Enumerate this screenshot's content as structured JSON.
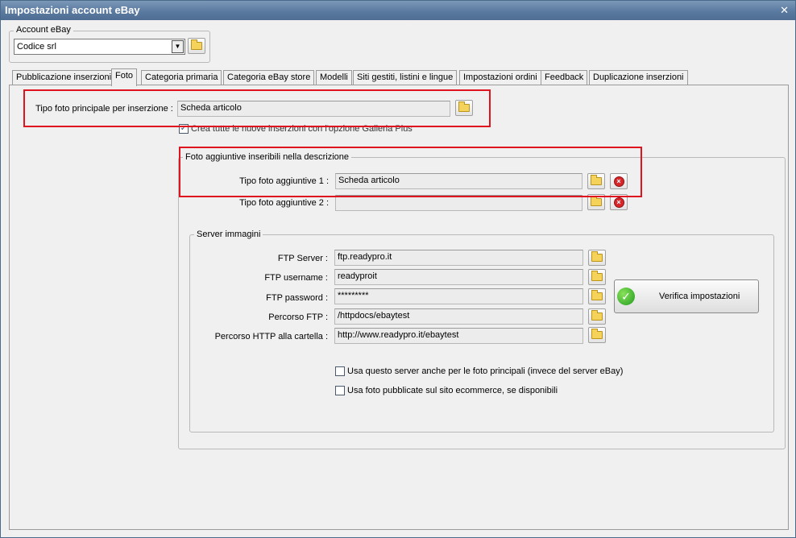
{
  "window": {
    "title": "Impostazioni account eBay",
    "close_glyph": "✕"
  },
  "account": {
    "group_label": "Account eBay",
    "selected": "Codice srl"
  },
  "tabs": [
    {
      "label": "Pubblicazione inserzioni",
      "active": false
    },
    {
      "label": "Foto",
      "active": true
    },
    {
      "label": "Categoria primaria",
      "active": false
    },
    {
      "label": "Categoria eBay store",
      "active": false
    },
    {
      "label": "Modelli",
      "active": false
    },
    {
      "label": "Siti gestiti, listini e lingue",
      "active": false
    },
    {
      "label": "Impostazioni ordini",
      "active": false
    },
    {
      "label": "Feedback",
      "active": false
    },
    {
      "label": "Duplicazione inserzioni",
      "active": false
    }
  ],
  "main_photo": {
    "label": "Tipo foto principale per inserzione :",
    "value": "Scheda articolo"
  },
  "gallery_plus": {
    "label": "Crea tutte le nuove inserzioni con l'opzione Galleria Plus",
    "checked": true
  },
  "additional": {
    "group_label": "Foto aggiuntive inseribili nella descrizione",
    "photo1_label": "Tipo foto aggiuntive 1 :",
    "photo1_value": "Scheda articolo",
    "photo2_label": "Tipo foto aggiuntive 2 :",
    "photo2_value": ""
  },
  "server": {
    "group_label": "Server immagini",
    "ftp_server_label": "FTP Server :",
    "ftp_server_value": "ftp.readypro.it",
    "ftp_username_label": "FTP username :",
    "ftp_username_value": "readyproit",
    "ftp_password_label": "FTP password :",
    "ftp_password_value": "*********",
    "ftp_path_label": "Percorso FTP :",
    "ftp_path_value": "/httpdocs/ebaytest",
    "http_path_label": "Percorso HTTP alla cartella :",
    "http_path_value": "http://www.readypro.it/ebaytest",
    "verify_label": "Verifica impostazioni",
    "opt1_label": "Usa questo server anche per le foto principali (invece del server eBay)",
    "opt1_checked": false,
    "opt2_label": "Usa foto pubblicate sul sito ecommerce, se disponibili",
    "opt2_checked": false
  },
  "colors": {
    "highlight": "#e0141e",
    "titlebar": "#5b7aa0"
  }
}
